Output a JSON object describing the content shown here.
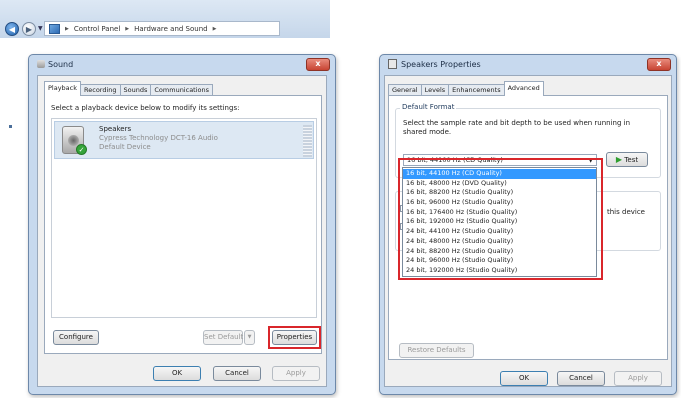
{
  "explorer": {
    "breadcrumb": [
      "Control Panel",
      "Hardware and Sound"
    ]
  },
  "sound": {
    "title": "Sound",
    "close": "x",
    "tabs": [
      "Playback",
      "Recording",
      "Sounds",
      "Communications"
    ],
    "instruction": "Select a playback device below to modify its settings:",
    "device": {
      "name": "Speakers",
      "line2": "Cypress Technology DCT-16 Audio",
      "status": "Default Device"
    },
    "buttons": {
      "configure": "Configure",
      "set_default": "Set Default",
      "properties": "Properties",
      "ok": "OK",
      "cancel": "Cancel",
      "apply": "Apply"
    }
  },
  "speakers": {
    "title": "Speakers Properties",
    "close": "x",
    "tabs": [
      "General",
      "Levels",
      "Enhancements",
      "Advanced"
    ],
    "group_title": "Default Format",
    "description": "Select the sample rate and bit depth to be used when running in shared mode.",
    "selected_format": "16 bit, 44100 Hz (CD Quality)",
    "test_button": "Test",
    "exclusive_fragment": "this device",
    "options": [
      "16 bit, 44100 Hz (CD Quality)",
      "16 bit, 48000 Hz (DVD Quality)",
      "16 bit, 88200 Hz (Studio Quality)",
      "16 bit, 96000 Hz (Studio Quality)",
      "16 bit, 176400 Hz (Studio Quality)",
      "16 bit, 192000 Hz (Studio Quality)",
      "24 bit, 44100 Hz (Studio Quality)",
      "24 bit, 48000 Hz (Studio Quality)",
      "24 bit, 88200 Hz (Studio Quality)",
      "24 bit, 96000 Hz (Studio Quality)",
      "24 bit, 192000 Hz (Studio Quality)"
    ],
    "buttons": {
      "restore": "Restore Defaults",
      "ok": "OK",
      "cancel": "Cancel",
      "apply": "Apply"
    }
  },
  "colors": {
    "highlight": "#3399ff",
    "callout_red": "#d9262b",
    "window_frame": "#c7d9ee"
  }
}
